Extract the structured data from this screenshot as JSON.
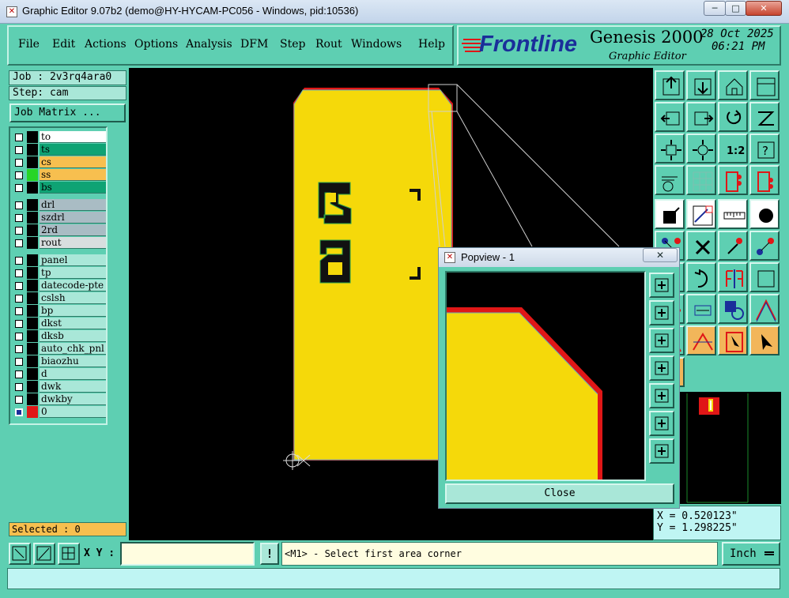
{
  "window": {
    "title": "Graphic Editor 9.07b2 (demo@HY-HYCAM-PC056 - Windows, pid:10536)",
    "min_label": "─",
    "max_label": "□",
    "close_label": "✕"
  },
  "menu": {
    "items": [
      "File",
      "Edit",
      "Actions",
      "Options",
      "Analysis",
      "DFM",
      "Step",
      "Rout",
      "Windows",
      "Help"
    ]
  },
  "brand": {
    "logo_text": "Frontline",
    "product": "Genesis 2000",
    "subtitle": "Graphic Editor",
    "date": "28 Oct 2025",
    "time": "06:21 PM"
  },
  "job": {
    "job_label": "Job : 2v3rq4ara0",
    "step_label": "Step: cam",
    "matrix_button": "Job Matrix ..."
  },
  "layers": {
    "groups": [
      [
        {
          "name": "to",
          "color": "#ffffff",
          "swatch": "#000000"
        },
        {
          "name": "ts",
          "color": "#0fa374",
          "swatch": "#000000"
        },
        {
          "name": "cs",
          "color": "#f7bf4f",
          "swatch": "#000000"
        },
        {
          "name": "ss",
          "color": "#f7bf4f",
          "swatch": "#27d527"
        },
        {
          "name": "bs",
          "color": "#0fa374",
          "swatch": "#000000"
        }
      ],
      [
        {
          "name": "drl",
          "color": "#a9bcc4",
          "swatch": "#000000"
        },
        {
          "name": "szdrl",
          "color": "#a9bcc4",
          "swatch": "#000000"
        },
        {
          "name": "2rd",
          "color": "#a9bcc4",
          "swatch": "#000000"
        },
        {
          "name": "rout",
          "color": "#d8dedf",
          "swatch": "#000000"
        }
      ],
      [
        {
          "name": "panel",
          "color": "#a9e7d8",
          "swatch": "#000000"
        },
        {
          "name": "tp",
          "color": "#a9e7d8",
          "swatch": "#000000"
        },
        {
          "name": "datecode-pte",
          "color": "#a9e7d8",
          "swatch": "#000000"
        },
        {
          "name": "cslsh",
          "color": "#a9e7d8",
          "swatch": "#000000"
        },
        {
          "name": "bp",
          "color": "#a9e7d8",
          "swatch": "#000000"
        },
        {
          "name": "dkst",
          "color": "#a9e7d8",
          "swatch": "#000000"
        },
        {
          "name": "dksb",
          "color": "#a9e7d8",
          "swatch": "#000000"
        },
        {
          "name": "auto_chk_pnl",
          "color": "#a9e7d8",
          "swatch": "#000000"
        },
        {
          "name": "biaozhu",
          "color": "#a9e7d8",
          "swatch": "#000000"
        },
        {
          "name": "d",
          "color": "#a9e7d8",
          "swatch": "#000000"
        },
        {
          "name": "dwk",
          "color": "#a9e7d8",
          "swatch": "#000000"
        },
        {
          "name": "dwkby",
          "color": "#a9e7d8",
          "swatch": "#000000"
        },
        {
          "name": "0",
          "color": "#a9e7d8",
          "swatch": "#e01717",
          "checked": true
        }
      ]
    ],
    "selected_label": "Selected : 0"
  },
  "popview": {
    "title": "Popview - 1",
    "close_label": "Close",
    "close_x": "✕"
  },
  "coords": {
    "x": "X = 0.520123\"",
    "y": "Y = 1.298225\""
  },
  "bottom": {
    "xy_label": "X Y :",
    "xy_value": "",
    "prompt": "<M1> - Select first area corner",
    "units": "Inch",
    "alert": "!"
  },
  "statusbar": {
    "text": ""
  },
  "colors": {
    "panel": "#5ecfb2",
    "board": "#f5d90a",
    "outline_red": "#e01717",
    "canvas": "#000000"
  }
}
